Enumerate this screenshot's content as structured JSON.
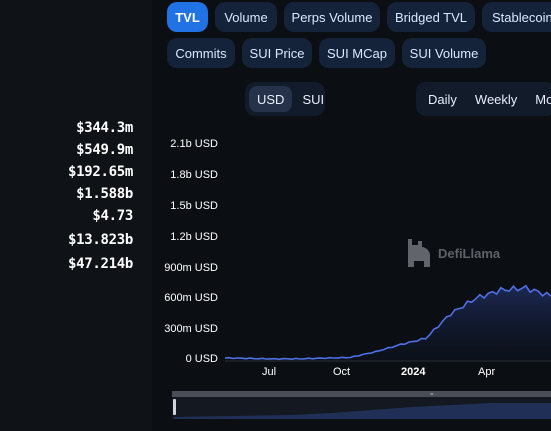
{
  "stats": [
    "$344.3m",
    "$549.9m",
    "$192.65m",
    "$1.588b",
    "$4.73",
    "$13.823b",
    "$47.214b"
  ],
  "tabs_row1": [
    {
      "label": "TVL",
      "active": true
    },
    {
      "label": "Volume",
      "active": false
    },
    {
      "label": "Perps Volume",
      "active": false
    },
    {
      "label": "Bridged TVL",
      "active": false
    },
    {
      "label": "Stablecoin",
      "active": false
    }
  ],
  "tabs_row2": [
    {
      "label": "Commits"
    },
    {
      "label": "SUI Price"
    },
    {
      "label": "SUI MCap"
    },
    {
      "label": "SUI Volume"
    }
  ],
  "currency_toggle": {
    "options": [
      "USD",
      "SUI"
    ],
    "selected": "USD"
  },
  "period_toggle": {
    "options": [
      "Daily",
      "Weekly",
      "Mont"
    ],
    "selected": "Daily"
  },
  "watermark": "DefiLlama",
  "chart_data": {
    "type": "area",
    "y_tick_labels": [
      "2.1b USD",
      "1.8b USD",
      "1.5b USD",
      "1.2b USD",
      "900m USD",
      "600m USD",
      "300m USD",
      "0 USD"
    ],
    "y_ticks": [
      2100,
      1800,
      1500,
      1200,
      900,
      600,
      300,
      0
    ],
    "ylim": [
      0,
      2100
    ],
    "y_unit": "m USD",
    "x_tick_labels": [
      "Jul",
      "Oct",
      "2024",
      "Apr"
    ],
    "x": [
      "2023-05",
      "2023-06",
      "2023-07",
      "2023-08",
      "2023-09",
      "2023-10",
      "2023-11",
      "2023-12",
      "2024-01",
      "2024-02",
      "2024-03",
      "2024-04",
      "2024-05",
      "2024-06"
    ],
    "series": [
      {
        "color": "#4f6fe6",
        "values": [
          20,
          15,
          10,
          12,
          18,
          25,
          80,
          150,
          210,
          450,
          600,
          680,
          700,
          620
        ]
      }
    ],
    "grid": false
  }
}
